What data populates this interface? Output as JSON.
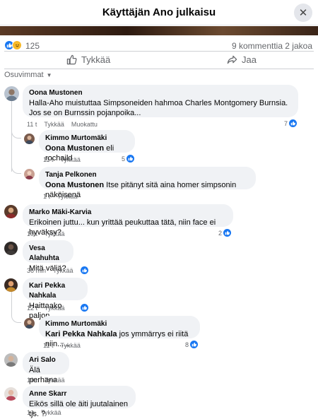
{
  "header": {
    "title": "Käyttäjän Ano julkaisu"
  },
  "stats": {
    "reactions": "125",
    "comments": "9 kommenttia",
    "shares": "2 jakoa"
  },
  "actions": {
    "like": "Tykkää",
    "share": "Jaa"
  },
  "filter": {
    "label": "Osuvimmat"
  },
  "comments": [
    {
      "name": "Oona Mustonen",
      "text": "Halla-Aho muistuttaa Simpsoneiden hahmoa Charles Montgomery Burnsia. Jos se on Burnssin pojanpoika...",
      "time": "11 t",
      "like": "Tykkää",
      "edited": "Muokattu",
      "likes": "7"
    },
    {
      "name": "Kimmo Murtomäki",
      "mention": "Oona Mustonen",
      "text": " eli rochaild",
      "time": "11 t",
      "like": "Tykkää",
      "likes": "5"
    },
    {
      "name": "Tanja Pelkonen",
      "mention": "Oona Mustonen",
      "text": " Itse pitänyt sitä aina homer simpsonin näköisenä",
      "time": "1 t",
      "like": "Tykkää"
    },
    {
      "name": "Marko Mäki-Karvia",
      "text": "Erikoinen juttu... kun yrittää peukuttaa tätä, niin face ei hyväksy?",
      "time": "10 t",
      "like": "Tykkää",
      "likes": "2"
    },
    {
      "name": "Vesa Alahuhta",
      "text": "Mitä väliä?",
      "time": "36 min",
      "like": "Tykkää"
    },
    {
      "name": "Kari Pekka Nahkala",
      "text": "Haittaako paljon",
      "time": "12 t",
      "like": "Tykkää"
    },
    {
      "name": "Kimmo Murtomäki",
      "mention": "Kari Pekka Nahkala",
      "text": " jos ymmärrys ei riitä niin......",
      "time": "11 t",
      "like": "Tykkää",
      "likes": "8"
    },
    {
      "name": "Ari Salo",
      "text": "Älä perhana",
      "time": "10 t",
      "like": "Tykkää"
    },
    {
      "name": "Anne Skarr",
      "text": "Eikös sillä ole äiti juutalainen tjs. ?",
      "time": "1 t",
      "like": "Tykkää"
    }
  ],
  "colors": {
    "accent": "#1877f2",
    "bubble": "#f0f2f5",
    "muted": "#65676b"
  }
}
